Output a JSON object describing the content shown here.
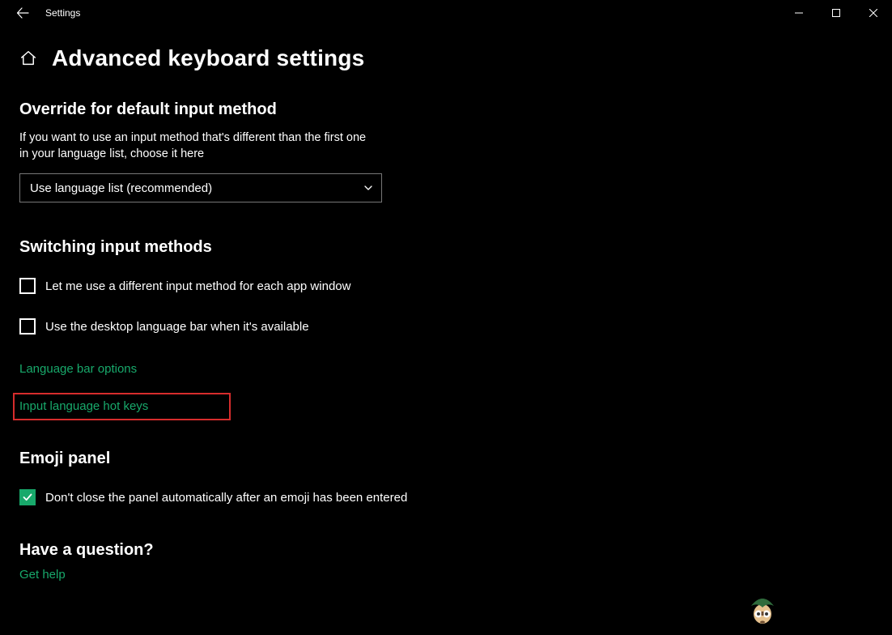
{
  "titlebar": {
    "app_title": "Settings"
  },
  "header": {
    "page_title": "Advanced keyboard settings"
  },
  "override": {
    "title": "Override for default input method",
    "desc": "If you want to use an input method that's different than the first one in your language list, choose it here",
    "dropdown_value": "Use language list (recommended)"
  },
  "switching": {
    "title": "Switching input methods",
    "checkbox1_label": "Let me use a different input method for each app window",
    "checkbox2_label": "Use the desktop language bar when it's available",
    "link1": "Language bar options",
    "link2": "Input language hot keys"
  },
  "emoji": {
    "title": "Emoji panel",
    "checkbox_label": "Don't close the panel automatically after an emoji has been entered"
  },
  "question": {
    "title": "Have a question?",
    "link": "Get help"
  }
}
